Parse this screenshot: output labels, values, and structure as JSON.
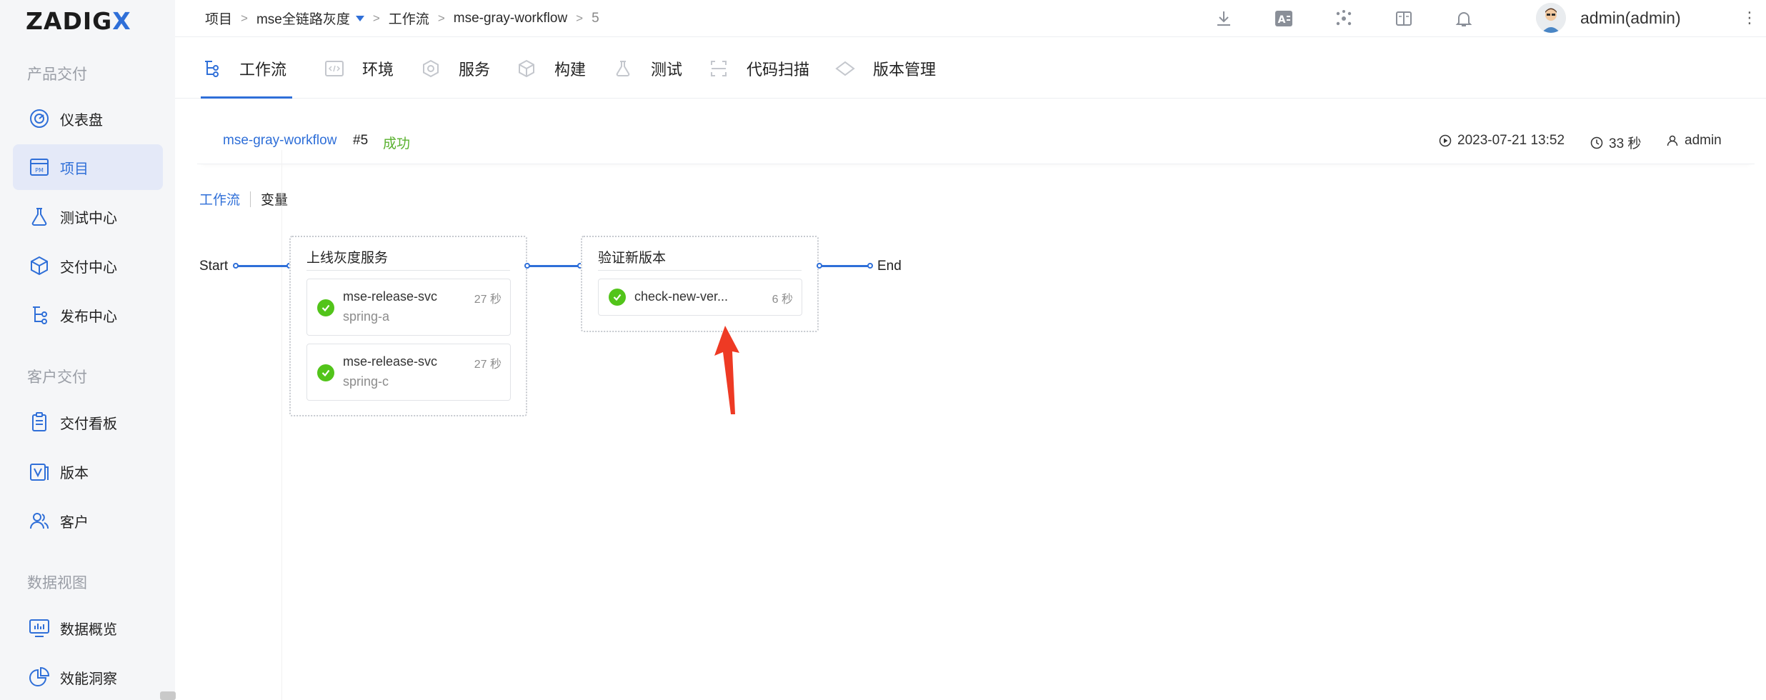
{
  "app": {
    "logo_main": "ZADIG",
    "logo_x": "X"
  },
  "sidebar": {
    "sections": [
      "产品交付",
      "客户交付",
      "数据视图"
    ],
    "items": [
      {
        "label": "仪表盘",
        "icon": "dashboard-icon"
      },
      {
        "label": "项目",
        "icon": "project-icon"
      },
      {
        "label": "测试中心",
        "icon": "flask-icon"
      },
      {
        "label": "交付中心",
        "icon": "cube-icon"
      },
      {
        "label": "发布中心",
        "icon": "release-tree-icon"
      },
      {
        "label": "交付看板",
        "icon": "clipboard-icon"
      },
      {
        "label": "版本",
        "icon": "version-icon"
      },
      {
        "label": "客户",
        "icon": "users-icon"
      },
      {
        "label": "数据概览",
        "icon": "monitor-chart-icon"
      },
      {
        "label": "效能洞察",
        "icon": "pie-chart-icon"
      }
    ]
  },
  "breadcrumb": {
    "items": [
      "项目",
      "mse全链路灰度",
      "工作流",
      "mse-gray-workflow",
      "5"
    ],
    "sep": ">"
  },
  "header": {
    "user": "admin(admin)"
  },
  "tabs": [
    "工作流",
    "环境",
    "服务",
    "构建",
    "测试",
    "代码扫描",
    "版本管理"
  ],
  "run": {
    "workflow": "mse-gray-workflow",
    "number": "#5",
    "status": "成功",
    "started": "2023-07-21 13:52",
    "duration": "33 秒",
    "creator": "admin"
  },
  "subtabs": {
    "active": "工作流",
    "other": "变量"
  },
  "pipeline": {
    "start": "Start",
    "end": "End",
    "stages": [
      {
        "title": "上线灰度服务",
        "jobs": [
          {
            "name": "mse-release-svc",
            "service": "spring-a",
            "time": "27 秒"
          },
          {
            "name": "mse-release-svc",
            "service": "spring-c",
            "time": "27 秒"
          }
        ]
      },
      {
        "title": "验证新版本",
        "jobs": [
          {
            "name": "check-new-ver...",
            "time": "6 秒"
          }
        ]
      }
    ]
  },
  "colors": {
    "accent": "#2f6fd8",
    "success": "#52c41a",
    "annotation": "#ee3a24"
  }
}
